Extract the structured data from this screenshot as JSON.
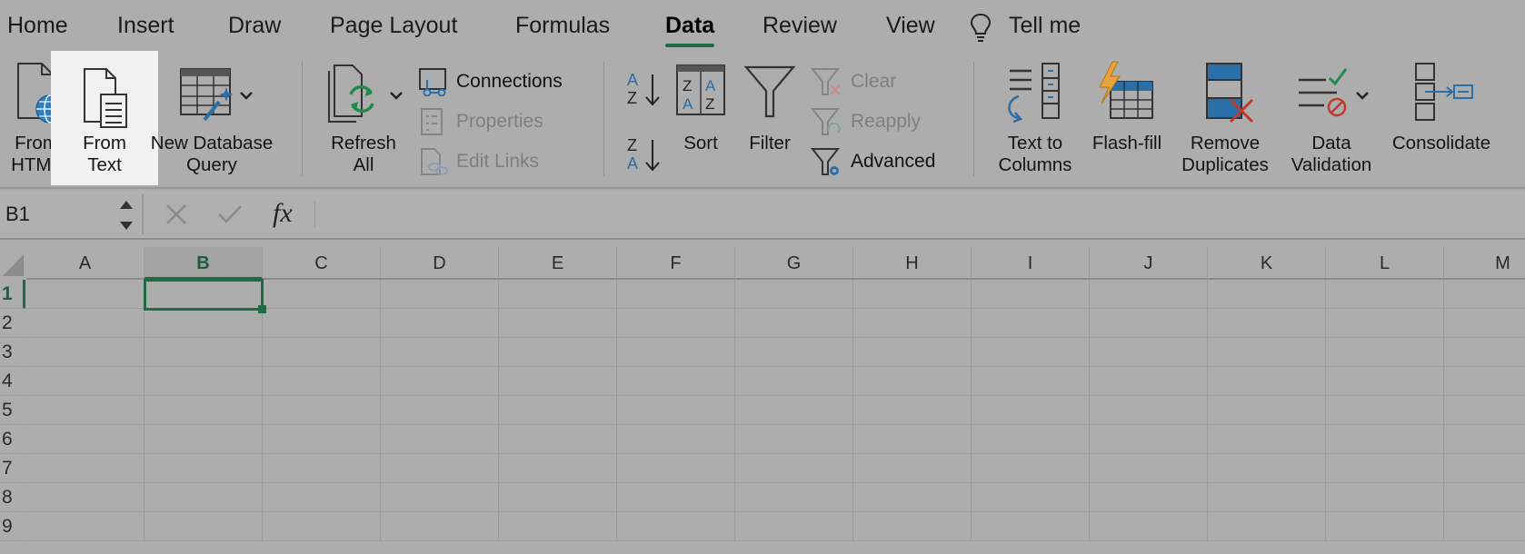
{
  "tabs": [
    {
      "label": "Home",
      "active": false
    },
    {
      "label": "Insert",
      "active": false
    },
    {
      "label": "Draw",
      "active": false
    },
    {
      "label": "Page Layout",
      "active": false
    },
    {
      "label": "Formulas",
      "active": false
    },
    {
      "label": "Data",
      "active": true
    },
    {
      "label": "Review",
      "active": false
    },
    {
      "label": "View",
      "active": false
    }
  ],
  "tell_me": {
    "label": "Tell me",
    "icon": "lightbulb-icon"
  },
  "ribbon": {
    "get_data": {
      "from_html": {
        "line1": "From",
        "line2": "HTML"
      },
      "from_text": {
        "line1": "From",
        "line2": "Text"
      },
      "new_db_query": {
        "line1": "New Database",
        "line2": "Query"
      }
    },
    "connections": {
      "refresh_all": {
        "line1": "Refresh",
        "line2": "All"
      },
      "connections": "Connections",
      "properties": "Properties",
      "edit_links": "Edit Links"
    },
    "sort_filter": {
      "sort": "Sort",
      "filter": "Filter",
      "clear": "Clear",
      "reapply": "Reapply",
      "advanced": "Advanced"
    },
    "tools": {
      "text_to_columns": {
        "line1": "Text to",
        "line2": "Columns"
      },
      "flash_fill": "Flash-fill",
      "remove_duplicates": {
        "line1": "Remove",
        "line2": "Duplicates"
      },
      "data_validation": {
        "line1": "Data",
        "line2": "Validation"
      },
      "consolidate": "Consolidate"
    }
  },
  "formula_bar": {
    "name_box": "B1",
    "fx": "fx",
    "formula": ""
  },
  "grid": {
    "columns": [
      "A",
      "B",
      "C",
      "D",
      "E",
      "F",
      "G",
      "H",
      "I",
      "J",
      "K",
      "L",
      "M"
    ],
    "rows": [
      "1",
      "2",
      "3",
      "4",
      "5",
      "6",
      "7",
      "8",
      "9"
    ],
    "selected_cell": "B1"
  },
  "colors": {
    "accent": "#1e6b44",
    "icon_blue": "#2b6fa8",
    "icon_green": "#1f8a4a",
    "icon_red": "#c0392b",
    "icon_orange": "#d98a1a"
  }
}
